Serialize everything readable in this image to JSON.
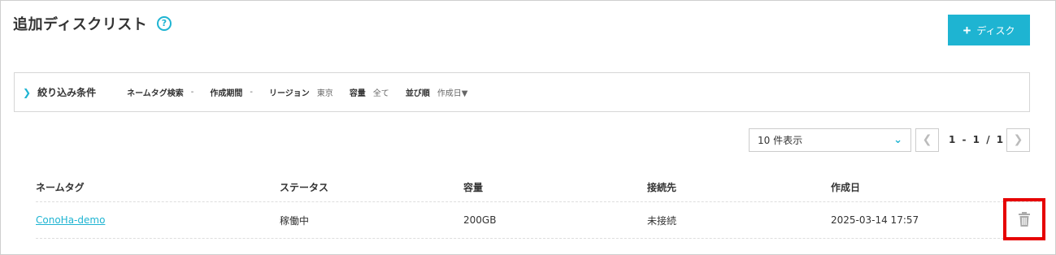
{
  "header": {
    "title": "追加ディスクリスト",
    "help_glyph": "?",
    "add_button_label": "ディスク",
    "add_button_glyph": "+"
  },
  "filter": {
    "title": "絞り込み条件",
    "items": [
      {
        "label": "ネームタグ検索",
        "value": "-"
      },
      {
        "label": "作成期間",
        "value": "-"
      },
      {
        "label": "リージョン",
        "value": "東京"
      },
      {
        "label": "容量",
        "value": "全て"
      },
      {
        "label": "並び順",
        "value": "作成日▼"
      }
    ]
  },
  "pagination": {
    "per_page": "10 件表示",
    "info": "1 - 1 / 1"
  },
  "table": {
    "headers": [
      "ネームタグ",
      "ステータス",
      "容量",
      "接続先",
      "作成日"
    ],
    "rows": [
      {
        "name": "ConoHa-demo",
        "status": "稼働中",
        "capacity": "200GB",
        "connection": "未接続",
        "created": "2025-03-14 17:57"
      }
    ]
  },
  "colors": {
    "accent": "#1eb4d2",
    "highlight": "#e60000"
  },
  "icons": {
    "help": "question-circle-icon",
    "add": "plus-icon",
    "filter_toggle": "chevron-right-icon",
    "select": "chevron-down-icon",
    "prev": "chevron-left-icon",
    "next": "chevron-right-icon",
    "delete": "trash-icon"
  }
}
